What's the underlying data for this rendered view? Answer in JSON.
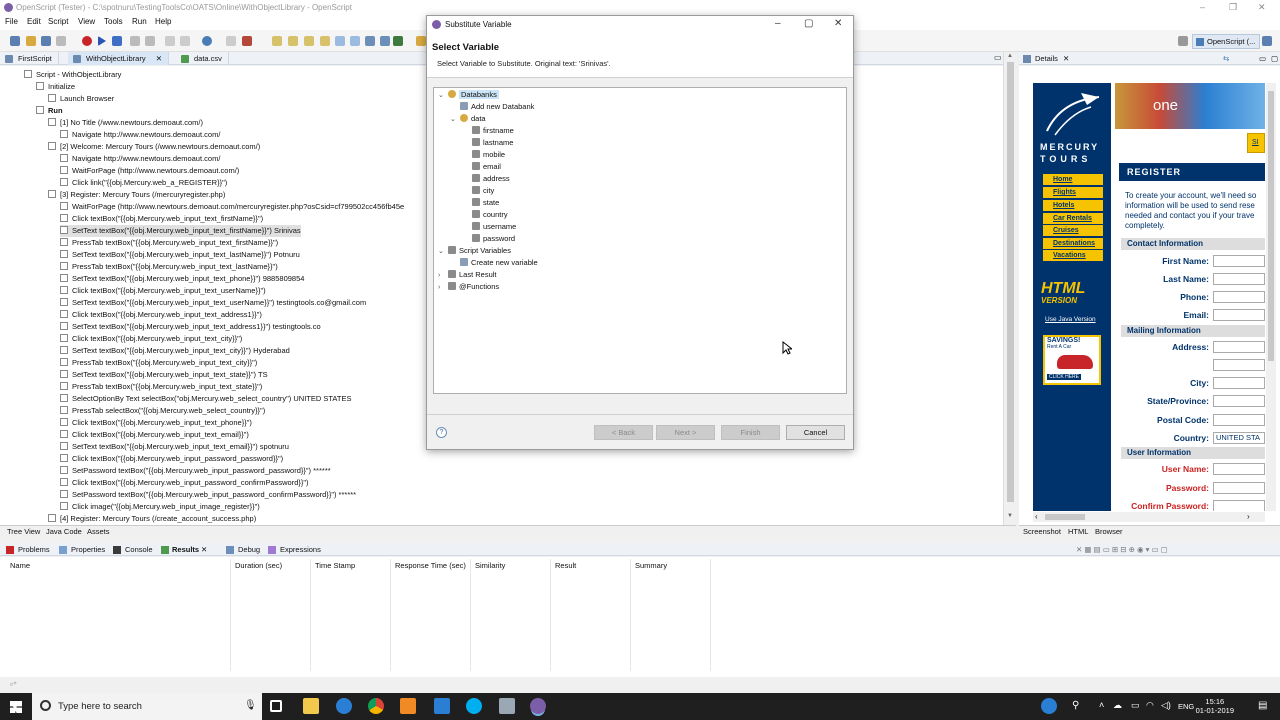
{
  "window": {
    "title": "OpenScript (Tester) - C:\\spotnuru\\TestingToolsCo\\OATS\\Online\\WithObjectLibrary - OpenScript",
    "minimize": "–",
    "maximize": "❐",
    "close": "✕"
  },
  "menu": [
    "File",
    "Edit",
    "Script",
    "View",
    "Tools",
    "Run",
    "Help"
  ],
  "perspective": "OpenScript (...",
  "editor_tabs": [
    {
      "label": "FirstScript",
      "active": false
    },
    {
      "label": "WithObjectLibrary",
      "active": true
    },
    {
      "label": "data.csv",
      "active": false
    }
  ],
  "script_tree": [
    {
      "indent": 0,
      "text": "Script - WithObjectLibrary"
    },
    {
      "indent": 1,
      "text": "Initialize"
    },
    {
      "indent": 2,
      "text": "Launch Browser"
    },
    {
      "indent": 1,
      "text": "Run",
      "bold": true
    },
    {
      "indent": 2,
      "text": "[1] No Title (/www.newtours.demoaut.com/)"
    },
    {
      "indent": 3,
      "text": "Navigate http://www.newtours.demoaut.com/"
    },
    {
      "indent": 2,
      "text": "[2] Welcome: Mercury Tours (/www.newtours.demoaut.com/)"
    },
    {
      "indent": 3,
      "text": "Navigate http://www.newtours.demoaut.com/"
    },
    {
      "indent": 3,
      "text": "WaitForPage (http://www.newtours.demoaut.com/)"
    },
    {
      "indent": 3,
      "text": "Click link(\"{{obj.Mercury.web_a_REGISTER}}\")"
    },
    {
      "indent": 2,
      "text": "[3] Register: Mercury Tours (/mercuryregister.php)"
    },
    {
      "indent": 3,
      "text": "WaitForPage (http://www.newtours.demoaut.com/mercuryregister.php?osCsid=cf799502cc456fb45e"
    },
    {
      "indent": 3,
      "text": "Click textBox(\"{{obj.Mercury.web_input_text_firstName}}\")"
    },
    {
      "indent": 3,
      "text": "SetText textBox(\"{{obj.Mercury.web_input_text_firstName}}\") Srinivas",
      "selected": true
    },
    {
      "indent": 3,
      "text": "PressTab textBox(\"{{obj.Mercury.web_input_text_firstName}}\")"
    },
    {
      "indent": 3,
      "text": "SetText textBox(\"{{obj.Mercury.web_input_text_lastName}}\") Potnuru"
    },
    {
      "indent": 3,
      "text": "PressTab textBox(\"{{obj.Mercury.web_input_text_lastName}}\")"
    },
    {
      "indent": 3,
      "text": "SetText textBox(\"{{obj.Mercury.web_input_text_phone}}\") 9885809854"
    },
    {
      "indent": 3,
      "text": "Click textBox(\"{{obj.Mercury.web_input_text_userName}}\")"
    },
    {
      "indent": 3,
      "text": "SetText textBox(\"{{obj.Mercury.web_input_text_userName}}\") testingtools.co@gmail.com"
    },
    {
      "indent": 3,
      "text": "Click textBox(\"{{obj.Mercury.web_input_text_address1}}\")"
    },
    {
      "indent": 3,
      "text": "SetText textBox(\"{{obj.Mercury.web_input_text_address1}}\") testingtools.co"
    },
    {
      "indent": 3,
      "text": "Click textBox(\"{{obj.Mercury.web_input_text_city}}\")"
    },
    {
      "indent": 3,
      "text": "SetText textBox(\"{{obj.Mercury.web_input_text_city}}\") Hyderabad"
    },
    {
      "indent": 3,
      "text": "PressTab textBox(\"{{obj.Mercury.web_input_text_city}}\")"
    },
    {
      "indent": 3,
      "text": "SetText textBox(\"{{obj.Mercury.web_input_text_state}}\") TS"
    },
    {
      "indent": 3,
      "text": "PressTab textBox(\"{{obj.Mercury.web_input_text_state}}\")"
    },
    {
      "indent": 3,
      "text": "SelectOptionBy Text selectBox(\"obj.Mercury.web_select_country\") UNITED STATES"
    },
    {
      "indent": 3,
      "text": "PressTab selectBox(\"{{obj.Mercury.web_select_country}}\")"
    },
    {
      "indent": 3,
      "text": "Click textBox(\"{{obj.Mercury.web_input_text_phone}}\")"
    },
    {
      "indent": 3,
      "text": "Click textBox(\"{{obj.Mercury.web_input_text_email}}\")"
    },
    {
      "indent": 3,
      "text": "SetText textBox(\"{{obj.Mercury.web_input_text_email}}\") spotnuru"
    },
    {
      "indent": 3,
      "text": "Click textBox(\"{{obj.Mercury.web_input_password_password}}\")"
    },
    {
      "indent": 3,
      "text": "SetPassword textBox(\"{{obj.Mercury.web_input_password_password}}\") ******"
    },
    {
      "indent": 3,
      "text": "Click textBox(\"{{obj.Mercury.web_input_password_confirmPassword}}\")"
    },
    {
      "indent": 3,
      "text": "SetPassword textBox(\"{{obj.Mercury.web_input_password_confirmPassword}}\") ******"
    },
    {
      "indent": 3,
      "text": "Click image(\"{{obj.Mercury.web_input_image_register}}\")"
    },
    {
      "indent": 2,
      "text": "[4] Register: Mercury Tours (/create_account_success.php)"
    }
  ],
  "editor_bottom_tabs": [
    "Tree View",
    "Java Code",
    "Assets"
  ],
  "details": {
    "tab": "Details",
    "bottom_tabs": [
      "Screenshot",
      "HTML",
      "Browser"
    ],
    "site": {
      "logo_line1": "MERCURY",
      "logo_line2": "TOURS",
      "banner_text": "one",
      "nav": [
        "Home",
        "Flights",
        "Hotels",
        "Car Rentals",
        "Cruises",
        "Destinations",
        "Vacations"
      ],
      "html_version_1": "HTML",
      "html_version_2": "VERSION",
      "java_link": "Use Java Version",
      "savings_1": "SAVINGS!",
      "savings_2": "Rent A Car",
      "savings_3": "CLICK HERE",
      "register": "REGISTER",
      "sign_tab": "SI",
      "intro": "To create your account, we'll need so information will be used to send rese needed and contact you if your trave completely.",
      "sections": [
        "Contact Information",
        "Mailing Information",
        "User Information"
      ],
      "contact_fields": [
        "First Name:",
        "Last Name:",
        "Phone:",
        "Email:"
      ],
      "mailing_fields": [
        "Address:",
        "City:",
        "State/Province:",
        "Postal Code:",
        "Country:"
      ],
      "country_value": "UNITED STA",
      "user_fields": [
        "User Name:",
        "Password:",
        "Confirm Password:"
      ]
    }
  },
  "results_tabs": [
    "Problems",
    "Properties",
    "Console",
    "Results",
    "Debug",
    "Expressions"
  ],
  "results_columns": [
    "Name",
    "Duration (sec)",
    "Time Stamp",
    "Response Time (sec)",
    "Similarity",
    "Result",
    "Summary"
  ],
  "dialog": {
    "title": "Substitute Variable",
    "heading": "Select Variable",
    "description": "Select Variable to Substitute.  Original text: 'Srinivas'.",
    "tree": [
      {
        "indent": 0,
        "twisty": "⌄",
        "icon": "databank-icon",
        "text": "Databanks",
        "selected": true
      },
      {
        "indent": 1,
        "twisty": "",
        "icon": "add-icon",
        "text": "Add new Databank"
      },
      {
        "indent": 1,
        "twisty": "⌄",
        "icon": "databank-icon",
        "text": "data"
      },
      {
        "indent": 2,
        "twisty": "",
        "icon": "field-icon",
        "text": "firstname"
      },
      {
        "indent": 2,
        "twisty": "",
        "icon": "field-icon",
        "text": "lastname"
      },
      {
        "indent": 2,
        "twisty": "",
        "icon": "field-icon",
        "text": "mobile"
      },
      {
        "indent": 2,
        "twisty": "",
        "icon": "field-icon",
        "text": "email"
      },
      {
        "indent": 2,
        "twisty": "",
        "icon": "field-icon",
        "text": "address"
      },
      {
        "indent": 2,
        "twisty": "",
        "icon": "field-icon",
        "text": "city"
      },
      {
        "indent": 2,
        "twisty": "",
        "icon": "field-icon",
        "text": "state"
      },
      {
        "indent": 2,
        "twisty": "",
        "icon": "field-icon",
        "text": "country"
      },
      {
        "indent": 2,
        "twisty": "",
        "icon": "field-icon",
        "text": "username"
      },
      {
        "indent": 2,
        "twisty": "",
        "icon": "field-icon",
        "text": "password"
      },
      {
        "indent": 0,
        "twisty": "⌄",
        "icon": "variable-icon",
        "text": "Script Variables"
      },
      {
        "indent": 1,
        "twisty": "",
        "icon": "add-icon",
        "text": "Create new variable"
      },
      {
        "indent": 0,
        "twisty": "›",
        "icon": "variable-icon",
        "text": "Last Result"
      },
      {
        "indent": 0,
        "twisty": "›",
        "icon": "variable-icon",
        "text": "@Functions"
      }
    ],
    "help": "?",
    "back": "< Back",
    "next": "Next >",
    "finish": "Finish",
    "cancel": "Cancel"
  },
  "taskbar": {
    "search_placeholder": "Type here to search",
    "language": "ENG",
    "time": "15:16",
    "date": "01-01-2019"
  },
  "colors": {
    "accent": "#00336b",
    "yellow": "#f5c300",
    "selection": "#cce4f7"
  }
}
